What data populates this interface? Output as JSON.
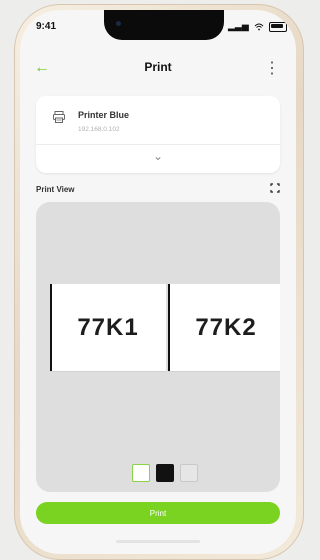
{
  "status_bar": {
    "time": "9:41"
  },
  "app_bar": {
    "title": "Print"
  },
  "printer": {
    "name": "Printer Blue",
    "ip": "192.168.0.102"
  },
  "print_view": {
    "label": "Print View",
    "labels": [
      "77K1",
      "77K2"
    ]
  },
  "primary_action": {
    "label": "Print"
  },
  "colors": {
    "accent": "#7ad321"
  },
  "icons": {
    "back": "arrow-left-icon",
    "more": "kebab-icon",
    "printer": "printer-icon",
    "expand": "chevron-down-icon",
    "fullscreen": "fullscreen-icon"
  }
}
